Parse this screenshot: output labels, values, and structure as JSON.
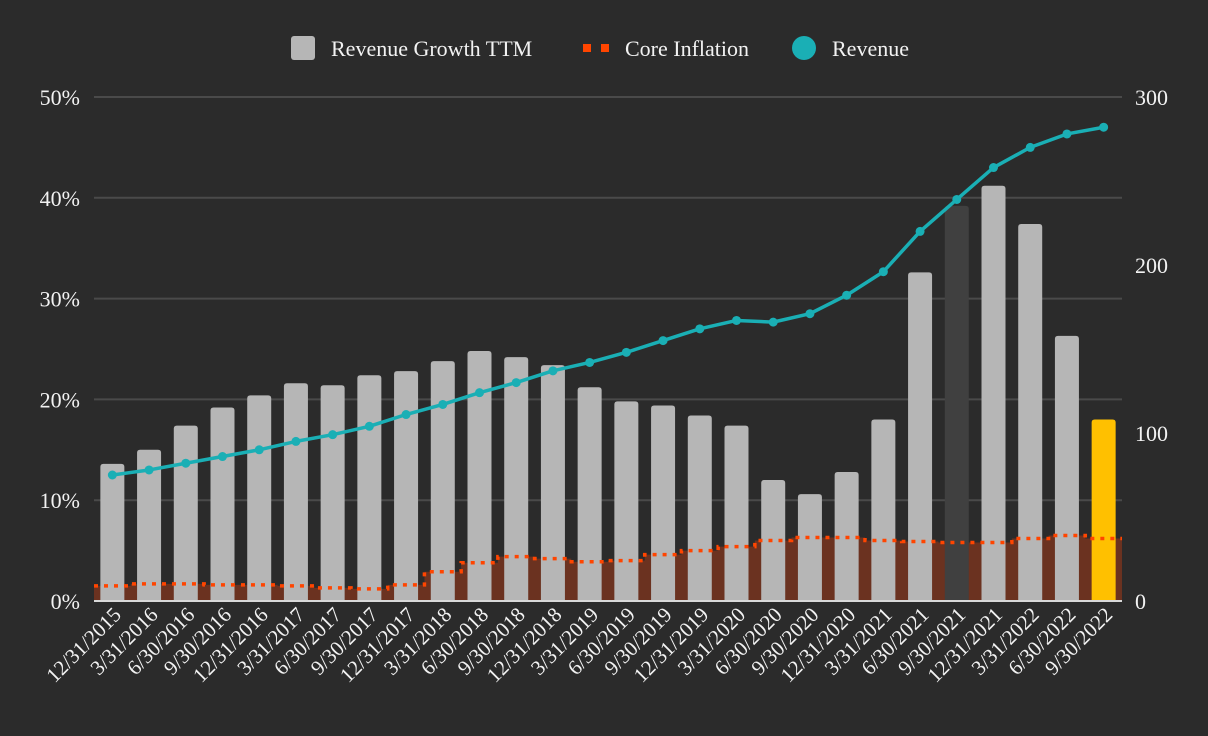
{
  "chart_data": {
    "type": "bar",
    "title": "",
    "xlabel": "",
    "ylabel": "",
    "y2label": "",
    "legend_position": "top-center",
    "grid": true,
    "ylim": [
      0,
      50
    ],
    "y2lim": [
      0,
      300
    ],
    "yticks": [
      "0%",
      "10%",
      "20%",
      "30%",
      "40%",
      "50%"
    ],
    "y2ticks": [
      "0",
      "100",
      "200",
      "300"
    ],
    "categories": [
      "12/31/2015",
      "3/31/2016",
      "6/30/2016",
      "9/30/2016",
      "12/31/2016",
      "3/31/2017",
      "6/30/2017",
      "9/30/2017",
      "12/31/2017",
      "3/31/2018",
      "6/30/2018",
      "9/30/2018",
      "12/31/2018",
      "3/31/2019",
      "6/30/2019",
      "9/30/2019",
      "12/31/2019",
      "3/31/2020",
      "6/30/2020",
      "9/30/2020",
      "12/31/2020",
      "3/31/2021",
      "6/30/2021",
      "9/30/2021",
      "12/31/2021",
      "3/31/2022",
      "6/30/2022",
      "9/30/2022"
    ],
    "series": [
      {
        "name": "Revenue Growth TTM",
        "type": "bar",
        "axis": "left",
        "unit": "%",
        "color": "#b6b6b6",
        "highlight": {
          "9/30/2021": "#404040",
          "9/30/2022": "#ffc000"
        },
        "values": [
          13.6,
          15.0,
          17.4,
          19.2,
          20.4,
          21.6,
          21.4,
          22.4,
          22.8,
          23.8,
          24.8,
          24.2,
          23.4,
          21.2,
          19.8,
          19.4,
          18.4,
          17.4,
          12.0,
          10.6,
          12.8,
          18.0,
          32.6,
          39.2,
          41.2,
          37.4,
          26.3,
          18.0
        ]
      },
      {
        "name": "Core Inflation",
        "type": "area-dotted-line",
        "axis": "left",
        "unit": "%",
        "color": "#ff4500",
        "fill_color": "#6b3220",
        "values": [
          1.5,
          1.7,
          1.7,
          1.6,
          1.6,
          1.5,
          1.3,
          1.2,
          1.6,
          2.9,
          3.8,
          4.4,
          4.2,
          3.9,
          4.0,
          4.6,
          5.0,
          5.4,
          6.0,
          6.3,
          6.3,
          6.0,
          5.9,
          5.8,
          5.8,
          6.2,
          6.5,
          6.2
        ]
      },
      {
        "name": "Revenue",
        "type": "line",
        "axis": "right",
        "color": "#1aafb5",
        "values": [
          75,
          78,
          82,
          86,
          90,
          95,
          99,
          104,
          111,
          117,
          124,
          130,
          137,
          142,
          148,
          155,
          162,
          167,
          166,
          171,
          182,
          196,
          220,
          239,
          258,
          270,
          278,
          282
        ]
      }
    ]
  },
  "legend": [
    {
      "label": "Revenue Growth TTM",
      "icon": "gray-rounded-square"
    },
    {
      "label": "Core Inflation",
      "icon": "orange-dotted-line"
    },
    {
      "label": "Revenue",
      "icon": "teal-circle"
    }
  ]
}
